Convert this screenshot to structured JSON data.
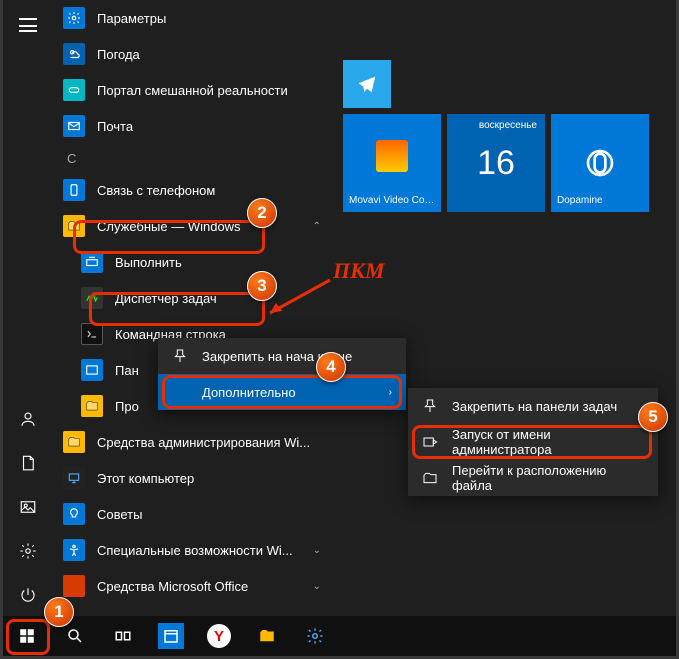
{
  "rail": {
    "hamburger": "menu"
  },
  "apps": {
    "items": [
      {
        "label": "Параметры",
        "icon": "gear",
        "color": "#0078d7"
      },
      {
        "label": "Погода",
        "icon": "weather",
        "color": "#0063b1"
      },
      {
        "label": "Портал смешанной реальности",
        "icon": "portal",
        "color": "#00b7c3"
      },
      {
        "label": "Почта",
        "icon": "mail",
        "color": "#0078d7"
      }
    ],
    "letter_c": "С",
    "c_items": [
      {
        "label": "Связь с телефоном",
        "icon": "phone",
        "color": "#0078d7"
      },
      {
        "label": "Служебные — Windows",
        "icon": "folder",
        "color": "#ffb900",
        "expanded": true
      },
      {
        "label": "Выполнить",
        "icon": "run",
        "color": "#0078d7",
        "sub": true
      },
      {
        "label": "Диспетчер задач",
        "icon": "task",
        "color": "#444",
        "sub": true
      },
      {
        "label": "Командная строка",
        "icon": "cmd",
        "color": "#111",
        "sub": true
      },
      {
        "label": "Пан",
        "icon": "panel",
        "color": "#0078d7",
        "sub": true
      },
      {
        "label": "Про",
        "icon": "explorer",
        "color": "#ffb900",
        "sub": true
      },
      {
        "label": "Средства администрирования Wi...",
        "icon": "admin",
        "color": "#ffb900"
      },
      {
        "label": "Этот компьютер",
        "icon": "pc",
        "color": "#0078d7"
      },
      {
        "label": "Советы",
        "icon": "tips",
        "color": "#0078d7"
      },
      {
        "label": "Специальные возможности Wi...",
        "icon": "access",
        "color": "#0078d7",
        "chev": true
      },
      {
        "label": "Средства Microsoft Office",
        "icon": "office",
        "color": "#d83b01",
        "chev": true
      }
    ]
  },
  "tiles": {
    "telegram": "",
    "movavi": "Movavi Video Converter...",
    "day_top": "воскресенье",
    "day": "16",
    "dopamine": "Dopamine"
  },
  "ctx1": {
    "pin": "Закрепить на нача        кране",
    "more": "Дополнительно"
  },
  "ctx2": {
    "pin_tb": "Закрепить на панели задач",
    "admin": "Запуск от имени администратора",
    "loc": "Перейти к расположению файла"
  },
  "annot": {
    "pkm": "ПКМ",
    "b1": "1",
    "b2": "2",
    "b3": "3",
    "b4": "4",
    "b5": "5"
  }
}
